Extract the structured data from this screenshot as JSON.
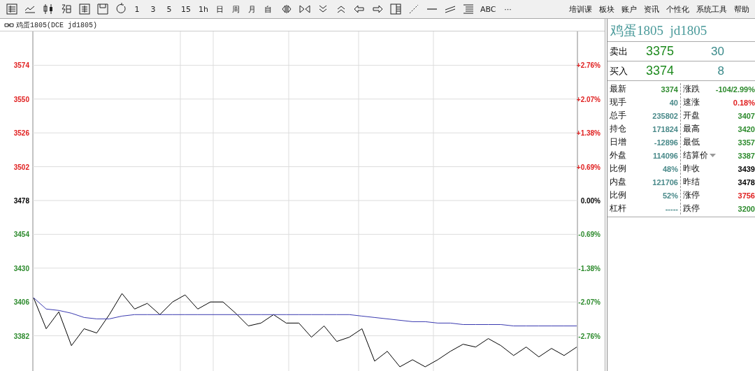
{
  "toolbar": {
    "items": [
      {
        "kind": "icon"
      },
      {
        "kind": "icon"
      },
      {
        "kind": "icon"
      },
      {
        "kind": "icon"
      },
      {
        "kind": "icon"
      },
      {
        "kind": "icon"
      },
      {
        "kind": "icon"
      },
      {
        "kind": "text",
        "label": "1"
      },
      {
        "kind": "text",
        "label": "3"
      },
      {
        "kind": "text",
        "label": "5"
      },
      {
        "kind": "text",
        "label": "15"
      },
      {
        "kind": "text",
        "label": "1h"
      },
      {
        "kind": "text",
        "label": "日"
      },
      {
        "kind": "text",
        "label": "周"
      },
      {
        "kind": "text",
        "label": "月"
      },
      {
        "kind": "text",
        "label": "自"
      },
      {
        "kind": "icon"
      },
      {
        "kind": "icon"
      },
      {
        "kind": "icon"
      },
      {
        "kind": "icon"
      },
      {
        "kind": "icon"
      },
      {
        "kind": "icon"
      },
      {
        "kind": "icon"
      },
      {
        "kind": "icon"
      },
      {
        "kind": "icon"
      },
      {
        "kind": "icon"
      },
      {
        "kind": "icon"
      },
      {
        "kind": "text",
        "label": "ABC"
      },
      {
        "kind": "text",
        "label": "···"
      }
    ],
    "menu": [
      "培训课",
      "板块",
      "账户",
      "资讯",
      "个性化",
      "系统工具",
      "帮助"
    ]
  },
  "chart_header": {
    "title": "鸡蛋1805(DCE jd1805)"
  },
  "chart": {
    "chart_data": {
      "type": "line",
      "ylim": [
        3357,
        3598
      ],
      "yticks": [
        3382,
        3406,
        3430,
        3454,
        3478,
        3502,
        3526,
        3550,
        3574
      ],
      "grid": true,
      "series": [
        {
          "color": "#000000",
          "values": [
            3409,
            3387,
            3399,
            3375,
            3387,
            3384,
            3397,
            3412,
            3401,
            3405,
            3397,
            3406,
            3411,
            3401,
            3406,
            3406,
            3398,
            3389,
            3391,
            3397,
            3391,
            3391,
            3381,
            3389,
            3378,
            3381,
            3387,
            3364,
            3371,
            3360,
            3365,
            3360,
            3365,
            3371,
            3376,
            3374,
            3380,
            3375,
            3368,
            3374,
            3367,
            3373,
            3368,
            3374
          ]
        },
        {
          "color": "#3a3ab0",
          "values": [
            3409,
            3401,
            3400,
            3398,
            3395,
            3394,
            3394,
            3396,
            3397,
            3397,
            3397,
            3397,
            3397,
            3397,
            3397,
            3397,
            3397,
            3397,
            3397,
            3397,
            3397,
            3397,
            3397,
            3397,
            3397,
            3397,
            3396,
            3395,
            3394,
            3393,
            3392,
            3392,
            3391,
            3391,
            3390,
            3390,
            3390,
            3390,
            3389,
            3389,
            3389,
            3389,
            3389,
            3389
          ]
        }
      ]
    },
    "right_axis_labels": [
      "+2.76%",
      "+2.07%",
      "+1.38%",
      "+0.69%",
      "0.00%",
      "-0.69%",
      "-1.38%",
      "-2.07%",
      "-2.76%"
    ]
  },
  "quote": {
    "title": "鸡蛋1805  jd1805",
    "book": [
      {
        "label": "卖出",
        "price": "3375",
        "volume": "30"
      },
      {
        "label": "买入",
        "price": "3374",
        "volume": "8"
      }
    ],
    "stats": [
      {
        "label": "最新",
        "value": "3374",
        "up": false,
        "down": true,
        "label2": "涨跌",
        "value2": "-104/2.99%",
        "up2": false,
        "down2": true
      },
      {
        "label": "现手",
        "value": "40",
        "up": false,
        "down": false,
        "label2": "速涨",
        "value2": "0.18%",
        "up2": true,
        "down2": false
      },
      {
        "label": "总手",
        "value": "235802",
        "up": false,
        "down": false,
        "label2": "开盘",
        "value2": "3407",
        "up2": false,
        "down2": true
      },
      {
        "label": "持仓",
        "value": "171824",
        "up": false,
        "down": false,
        "label2": "最高",
        "value2": "3420",
        "up2": false,
        "down2": true
      },
      {
        "label": "日增",
        "value": "-12896",
        "up": false,
        "down": false,
        "label2": "最低",
        "value2": "3357",
        "up2": false,
        "down2": true
      },
      {
        "label": "外盘",
        "value": "114096",
        "up": false,
        "down": false,
        "label2": "结算价",
        "dropdown": true,
        "value2": "3387",
        "up2": false,
        "down2": true
      },
      {
        "label": "比例",
        "value": "48%",
        "up": false,
        "down": false,
        "label2": "昨收",
        "value2": "3439",
        "up2": false,
        "down2": false
      },
      {
        "label": "内盘",
        "value": "121706",
        "up": false,
        "down": false,
        "label2": "昨结",
        "value2": "3478",
        "up2": false,
        "down2": false
      },
      {
        "label": "比例",
        "value": "52%",
        "up": false,
        "down": false,
        "label2": "涨停",
        "value2": "3756",
        "up2": true,
        "down2": false
      },
      {
        "label": "杠杆",
        "value": "-----",
        "up": false,
        "down": false,
        "label2": "跌停",
        "value2": "3200",
        "up2": false,
        "down2": true
      }
    ]
  }
}
